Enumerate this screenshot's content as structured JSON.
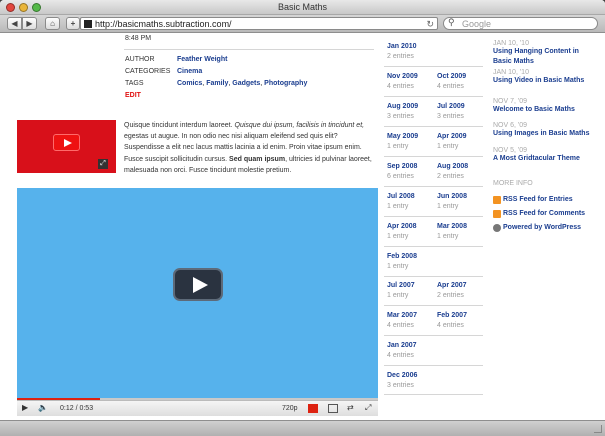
{
  "window": {
    "title": "Basic Maths"
  },
  "toolbar": {
    "back": "◀",
    "forward": "▶",
    "home": "⌂",
    "add": "+",
    "url": "http://basicmaths.subtraction.com/",
    "reload": "↻",
    "search_placeholder": "Google",
    "search_icon": "⚲"
  },
  "post": {
    "time": "8:48 PM",
    "meta": [
      {
        "key": "AUTHOR",
        "value": "Feather Weight"
      },
      {
        "key": "CATEGORIES",
        "value": "Cinema"
      },
      {
        "key": "TAGS",
        "tags": [
          "Comics",
          "Family",
          "Gadgets",
          "Photography"
        ]
      }
    ],
    "edit": "EDIT",
    "para1": "Quisque tincidunt interdum laoreet. ",
    "para_italic": "Quisque dui ipsum, facilisis in tincidunt et,",
    "para2": " egestas ut augue. In non odio nec nisi aliquam eleifend sed quis elit? Suspendisse a elit nec lacus mattis lacinia a id enim. Proin vitae ipsum enim. Fusce suscipit sollicitudin cursus. ",
    "para_bold": "Sed quam ipsum",
    "para3": ", ultricies id pulvinar laoreet, malesuada non orci. Fusce tincidunt molestie pretium."
  },
  "player": {
    "time": "0:12 / 0:53",
    "quality": "720p",
    "progress": 0.23
  },
  "archives": [
    {
      "month": "Jan 2010",
      "count": "2 entries"
    },
    {
      "month": "Nov 2009",
      "count": "4 entries"
    },
    {
      "month": "Oct 2009",
      "count": "4 entries"
    },
    {
      "month": "Aug 2009",
      "count": "3 entries"
    },
    {
      "month": "Jul 2009",
      "count": "3 entries"
    },
    {
      "month": "May 2009",
      "count": "1 entry"
    },
    {
      "month": "Apr 2009",
      "count": "1 entry"
    },
    {
      "month": "Sep 2008",
      "count": "6 entries"
    },
    {
      "month": "Aug 2008",
      "count": "2 entries"
    },
    {
      "month": "Jul 2008",
      "count": "1 entry"
    },
    {
      "month": "Jun 2008",
      "count": "1 entry"
    },
    {
      "month": "Apr 2008",
      "count": "1 entry"
    },
    {
      "month": "Mar 2008",
      "count": "1 entry"
    },
    {
      "month": "Feb 2008",
      "count": "1 entry"
    },
    {
      "month": "Jul 2007",
      "count": "1 entry"
    },
    {
      "month": "Apr 2007",
      "count": "2 entries"
    },
    {
      "month": "Mar 2007",
      "count": "4 entries"
    },
    {
      "month": "Feb 2007",
      "count": "4 entries"
    },
    {
      "month": "Jan 2007",
      "count": "4 entries"
    },
    {
      "month": "Dec 2006",
      "count": "3 entries"
    }
  ],
  "recent": [
    {
      "date": "JAN 10, '10",
      "title": "Using Hanging Content in Basic Maths"
    },
    {
      "date": "JAN 10, '10",
      "title": "Using Video in Basic Maths"
    },
    {
      "date": "NOV 7, '09",
      "title": "Welcome to Basic Maths"
    },
    {
      "date": "NOV 6, '09",
      "title": "Using Images in Basic Maths"
    },
    {
      "date": "NOV 5, '09",
      "title": "A Most Gridtacular Theme"
    }
  ],
  "more_info": {
    "heading": "MORE INFO",
    "links": [
      "RSS Feed for Entries",
      "RSS Feed for Comments",
      "Powered by WordPress"
    ]
  },
  "colors": {
    "link": "#1a3d8f",
    "edit": "#e01212",
    "video_bg": "#56b2ec",
    "thumb_bg": "#d8101a"
  }
}
